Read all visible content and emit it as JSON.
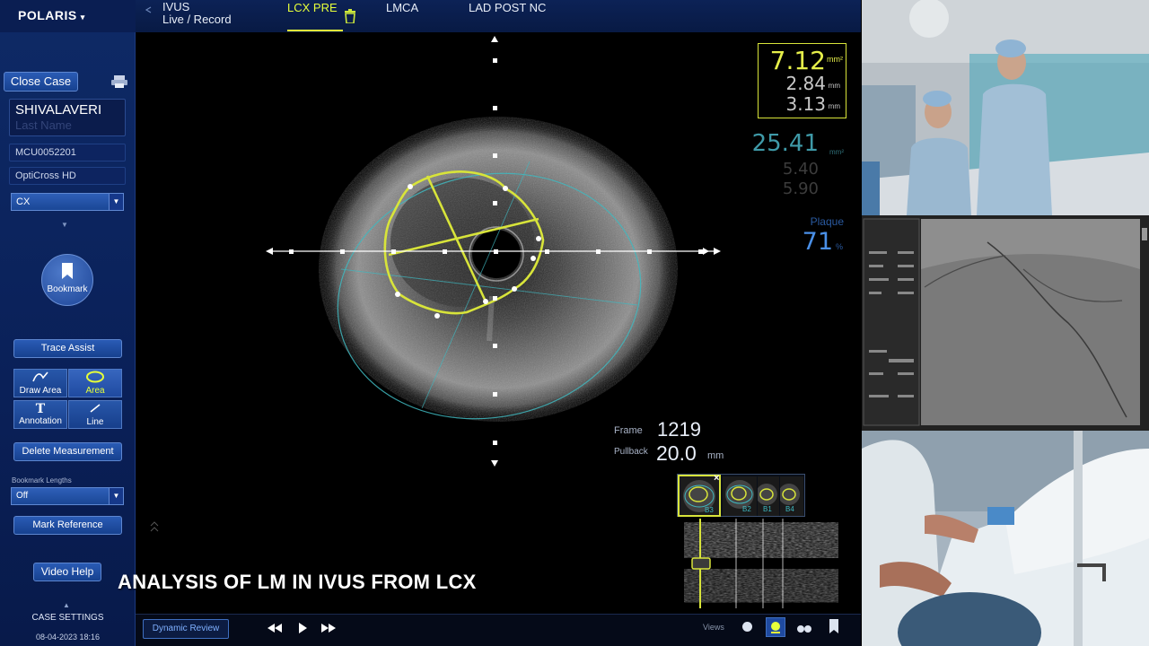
{
  "app": {
    "brand": "POLARIS"
  },
  "header": {
    "mode_line1": "IVUS",
    "mode_line2": "Live / Record",
    "tabs": [
      {
        "label": "LCX PRE"
      },
      {
        "label": "LMCA"
      },
      {
        "label": "LAD POST NC"
      }
    ]
  },
  "sidebar": {
    "close_case": "Close Case",
    "patient_name": "SHIVALAVERI",
    "last_name_placeholder": "Last Name",
    "patient_id": "MCU0052201",
    "catheter": "OptiCross HD",
    "vessel": "CX",
    "bookmark": "Bookmark",
    "trace_assist": "Trace Assist",
    "tools": [
      {
        "label": "Draw Area",
        "icon": "pencil-icon"
      },
      {
        "label": "Area",
        "icon": "area-icon"
      },
      {
        "label": "Annotation",
        "icon": "text-t-icon",
        "glyph": "T"
      },
      {
        "label": "Line",
        "icon": "line-icon"
      }
    ],
    "delete_measurement": "Delete Measurement",
    "bookmark_lengths_label": "Bookmark Lengths",
    "bookmark_lengths_value": "Off",
    "mark_reference": "Mark Reference",
    "video_help": "Video Help",
    "case_settings": "CASE SETTINGS",
    "datetime": "08-04-2023 18:16"
  },
  "measurements": {
    "lumen": {
      "area": "7.12",
      "area_unit": "mm²",
      "min_diam": "2.84",
      "max_diam": "3.13",
      "diam_unit": "mm"
    },
    "vessel": {
      "area": "25.41",
      "area_unit": "mm²",
      "min_diam": "5.40",
      "max_diam": "5.90"
    },
    "plaque": {
      "label": "Plaque",
      "value": "71",
      "unit": "%"
    }
  },
  "frame_info": {
    "frame_label": "Frame",
    "frame": "1219",
    "pullback_label": "Pullback",
    "pullback": "20.0",
    "pullback_unit": "mm"
  },
  "bookmarks": [
    {
      "label": "B3"
    },
    {
      "label": "B2"
    },
    {
      "label": "B1"
    },
    {
      "label": "B4"
    }
  ],
  "caption": "ANALYSIS OF LM IN IVUS FROM LCX",
  "bottom": {
    "dynamic_review": "Dynamic Review",
    "views": "Views"
  },
  "colors": {
    "lumen_trace": "#d8e43a",
    "vessel_trace": "#3fb8c0",
    "plaque_value": "#4a90e8"
  }
}
